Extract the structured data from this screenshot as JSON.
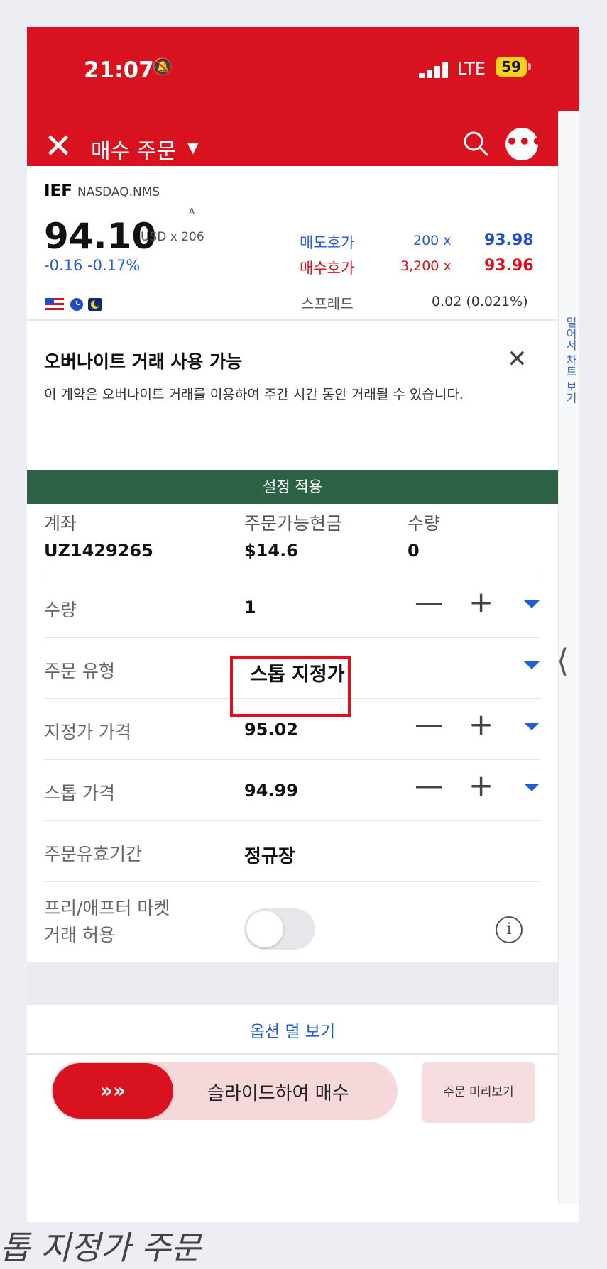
{
  "status_bar": {
    "time": "21:07",
    "network": "LTE",
    "battery": "59"
  },
  "nav": {
    "title": "매수 주문"
  },
  "quote": {
    "symbol": "IEF",
    "exchange": "NASDAQ.NMS",
    "price_flag": "A",
    "last_price": "94.10",
    "price_unit": "USD x 206",
    "change": "-0.16  -0.17%",
    "ask_label": "매도호가",
    "ask_size": "200 x",
    "ask_price": "93.98",
    "bid_label": "매수호가",
    "bid_size": "3,200 x",
    "bid_price": "93.96",
    "spread_label": "스프레드",
    "spread_value": "0.02 (0.021%)"
  },
  "banner": {
    "title": "오버나이트 거래 사용 가능",
    "text": "이 계약은 오버나이트 거래를 이용하여 주간 시간 동안 거래될 수 있습니다."
  },
  "apply_bar": "설정 적용",
  "account": {
    "account_label": "계좌",
    "account_value": "UZ1429265",
    "cash_label": "주문가능현금",
    "cash_value": "$14.6",
    "qty_label": "수량",
    "qty_value": "0"
  },
  "order_rows": {
    "quantity": {
      "label": "수량",
      "value": "1"
    },
    "order_type": {
      "label": "주문 유형",
      "value": "스톱 지정가"
    },
    "limit_price": {
      "label": "지정가 가격",
      "value": "95.02"
    },
    "stop_price": {
      "label": "스톱 가격",
      "value": "94.99"
    },
    "time_in_force": {
      "label": "주문유효기간",
      "value": "정규장"
    },
    "extended_hours": {
      "label_line1": "프리/애프터 마켓",
      "label_line2": "거래 허용",
      "enabled": false
    }
  },
  "less_options": "옵션 덜 보기",
  "slide_to_buy": "슬라이드하여 매수",
  "order_preview": "주문 미리보기",
  "chart_side_label": "밀어서 차트 보기",
  "caption": "톱 지정가 주문",
  "colors": {
    "brand_red": "#d8131f",
    "apply_green": "#2e6246",
    "link_blue": "#1f5fd3"
  }
}
